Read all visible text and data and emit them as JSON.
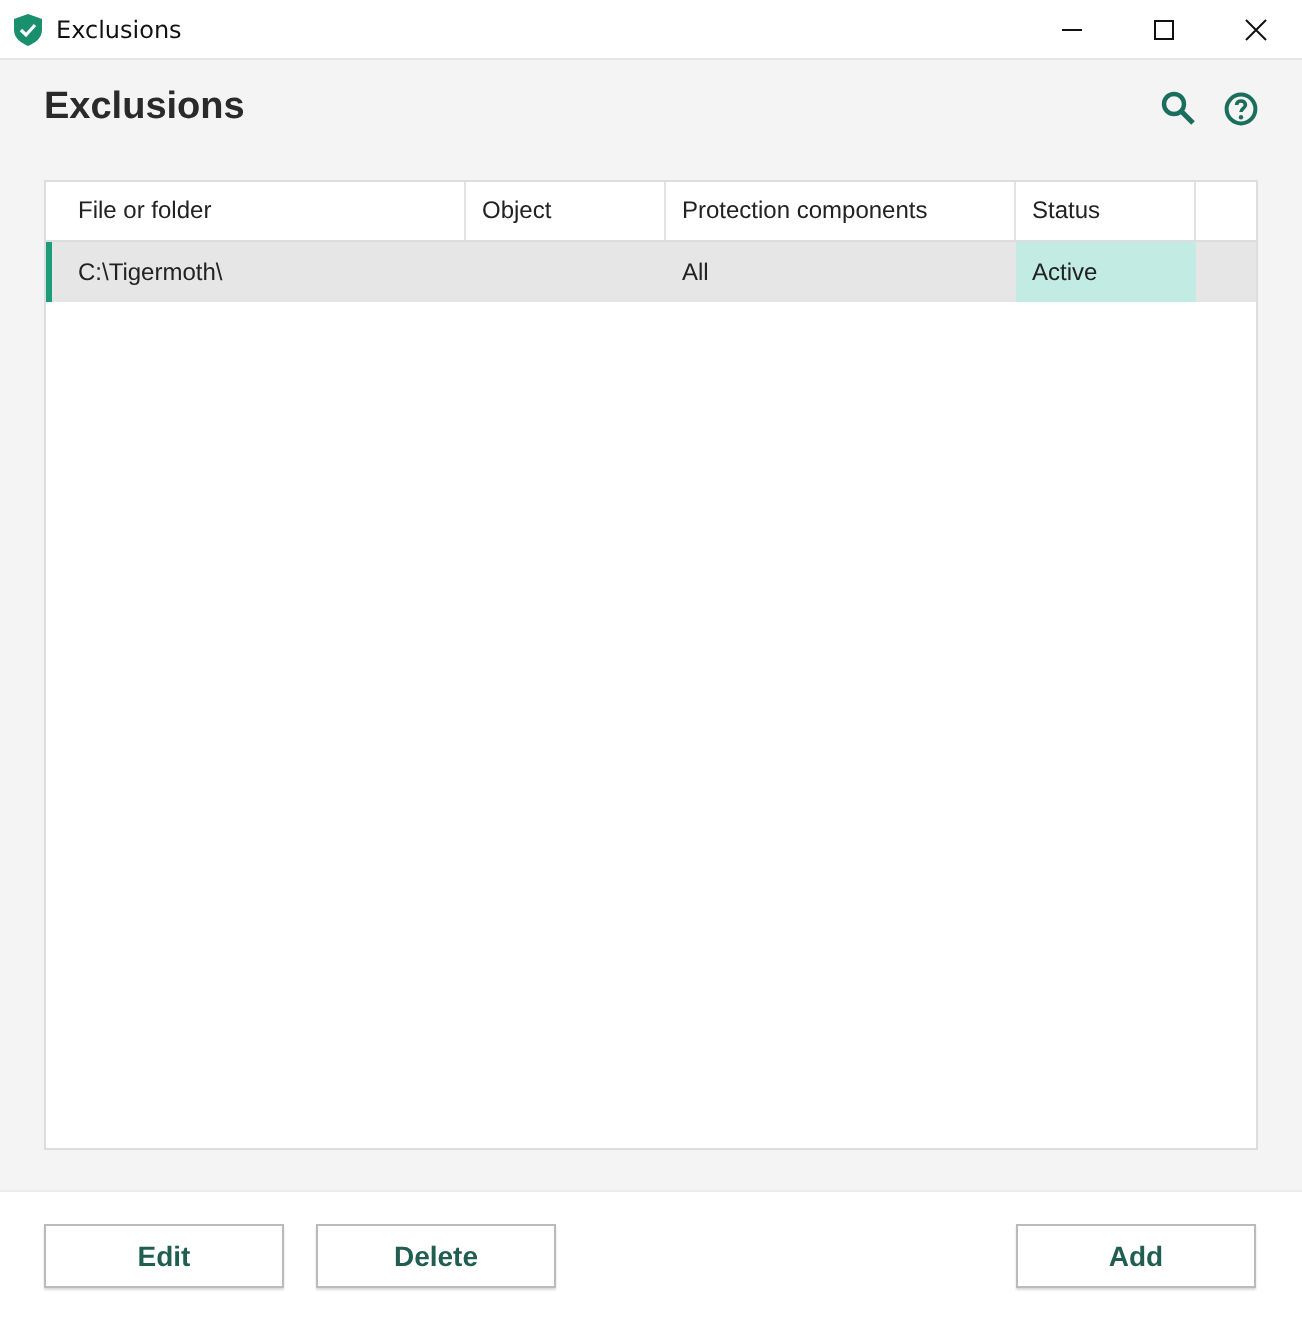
{
  "window": {
    "title": "Exclusions"
  },
  "header": {
    "title": "Exclusions"
  },
  "table": {
    "columns": [
      "File or folder",
      "Object",
      "Protection components",
      "Status"
    ],
    "rows": [
      {
        "cells": [
          "C:\\Tigermoth\\",
          "",
          "All",
          "Active"
        ],
        "selected": true,
        "active": true
      }
    ]
  },
  "left_buttons": [
    "Edit",
    "Delete"
  ],
  "right_buttons": [
    "Add"
  ]
}
